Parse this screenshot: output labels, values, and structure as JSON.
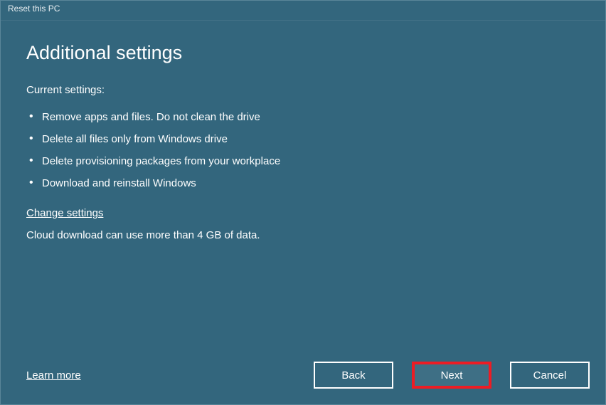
{
  "window": {
    "title": "Reset this PC"
  },
  "main": {
    "heading": "Additional settings",
    "subheading": "Current settings:",
    "settings": [
      "Remove apps and files. Do not clean the drive",
      "Delete all files only from Windows drive",
      "Delete provisioning packages from your workplace",
      "Download and reinstall Windows"
    ],
    "change_link": "Change settings",
    "note": "Cloud download can use more than 4 GB of data."
  },
  "footer": {
    "learn_more": "Learn more",
    "back": "Back",
    "next": "Next",
    "cancel": "Cancel"
  }
}
